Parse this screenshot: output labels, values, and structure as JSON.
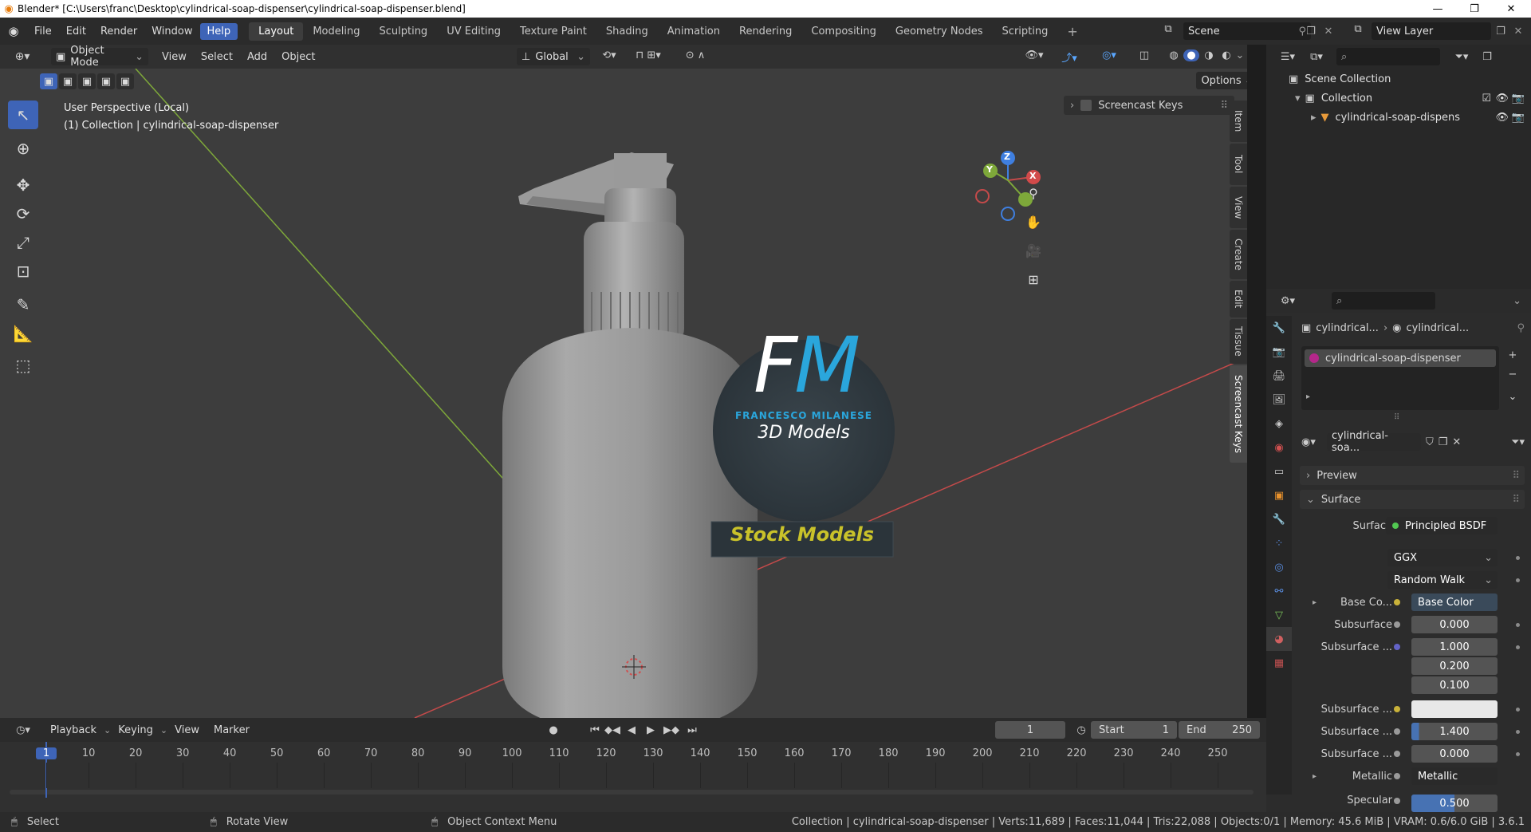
{
  "window": {
    "title": "Blender* [C:\\Users\\franc\\Desktop\\cylindrical-soap-dispenser\\cylindrical-soap-dispenser.blend]",
    "minimize": "—",
    "maximize": "❐",
    "close": "✕"
  },
  "menu": {
    "items": [
      "File",
      "Edit",
      "Render",
      "Window",
      "Help"
    ],
    "active": "Help"
  },
  "workspaces": {
    "tabs": [
      "Layout",
      "Modeling",
      "Sculpting",
      "UV Editing",
      "Texture Paint",
      "Shading",
      "Animation",
      "Rendering",
      "Compositing",
      "Geometry Nodes",
      "Scripting"
    ],
    "active": "Layout",
    "add": "+"
  },
  "scene": {
    "name": "Scene"
  },
  "view_layer": {
    "name": "View Layer"
  },
  "viewport_header": {
    "mode": "Object Mode",
    "menus": [
      "View",
      "Select",
      "Add",
      "Object"
    ],
    "transform_orientation": "Global",
    "options": "Options"
  },
  "viewport": {
    "perspective": "User Perspective (Local)",
    "collection_info": "(1) Collection | cylindrical-soap-dispenser",
    "screencast_keys": "Screencast Keys",
    "gizmo": {
      "z": "Z",
      "y": "Y",
      "x": "X"
    },
    "side_tabs": [
      "Item",
      "Tool",
      "View",
      "Create",
      "Edit",
      "Tissue",
      "Screencast Keys"
    ]
  },
  "logo": {
    "initials_f": "F",
    "initials_m": "M",
    "brand": "FRANCESCO MILANESE",
    "subtitle": "3D Models",
    "tagline": "Stock Models"
  },
  "outliner": {
    "scene_collection": "Scene Collection",
    "collection": "Collection",
    "object": "cylindrical-soap-dispens"
  },
  "properties": {
    "breadcrumb_object": "cylindrical...",
    "breadcrumb_material": "cylindrical...",
    "material_slot": "cylindrical-soap-dispenser",
    "material_name": "cylindrical-soa...",
    "panels": {
      "preview": "Preview",
      "surface": "Surface"
    },
    "surface_label": "Surface",
    "surface_value": "Principled BSDF",
    "distribution": "GGX",
    "subsurface_method": "Random Walk",
    "rows": [
      {
        "label": "Base Co...",
        "value": "Base Color",
        "dot": "#c9b23a"
      },
      {
        "label": "Subsurface",
        "value": "0.000",
        "dot": "#9a9a9a"
      },
      {
        "label": "Subsurface ...",
        "value": "1.000",
        "dot": "#6363c7"
      },
      {
        "label": "",
        "value": "0.200",
        "dot": ""
      },
      {
        "label": "",
        "value": "0.100",
        "dot": ""
      },
      {
        "label": "Subsurface ...",
        "value": "",
        "dot": "#c9b23a"
      },
      {
        "label": "Subsurface ...",
        "value": "1.400",
        "dot": "#9a9a9a"
      },
      {
        "label": "Subsurface ...",
        "value": "0.000",
        "dot": "#9a9a9a"
      },
      {
        "label": "Metallic",
        "value": "Metallic",
        "dot": "#9a9a9a"
      },
      {
        "label": "Specular",
        "value": "0.500",
        "dot": "#9a9a9a"
      }
    ]
  },
  "timeline": {
    "menus": [
      "Playback",
      "Keying",
      "View",
      "Marker"
    ],
    "current_frame": "1",
    "start_label": "Start",
    "start": "1",
    "end_label": "End",
    "end": "250",
    "ticks": [
      "1",
      "10",
      "20",
      "30",
      "40",
      "50",
      "60",
      "70",
      "80",
      "90",
      "100",
      "110",
      "120",
      "130",
      "140",
      "150",
      "160",
      "170",
      "180",
      "190",
      "200",
      "210",
      "220",
      "230",
      "240",
      "250"
    ]
  },
  "status": {
    "select": "Select",
    "rotate": "Rotate View",
    "context": "Object Context Menu",
    "stats": "Collection | cylindrical-soap-dispenser | Verts:11,689 | Faces:11,044 | Tris:22,088 | Objects:0/1 | Memory: 45.6 MiB | VRAM: 0.6/6.0 GiB | 3.6.1"
  },
  "colors": {
    "accent": "#3e64b7",
    "viewport_bg": "#3d3d3d",
    "logo_blue": "#2aa6dc",
    "logo_yellow": "#c9c22a",
    "x_axis": "#c44a4a",
    "y_axis": "#7ea83a"
  }
}
